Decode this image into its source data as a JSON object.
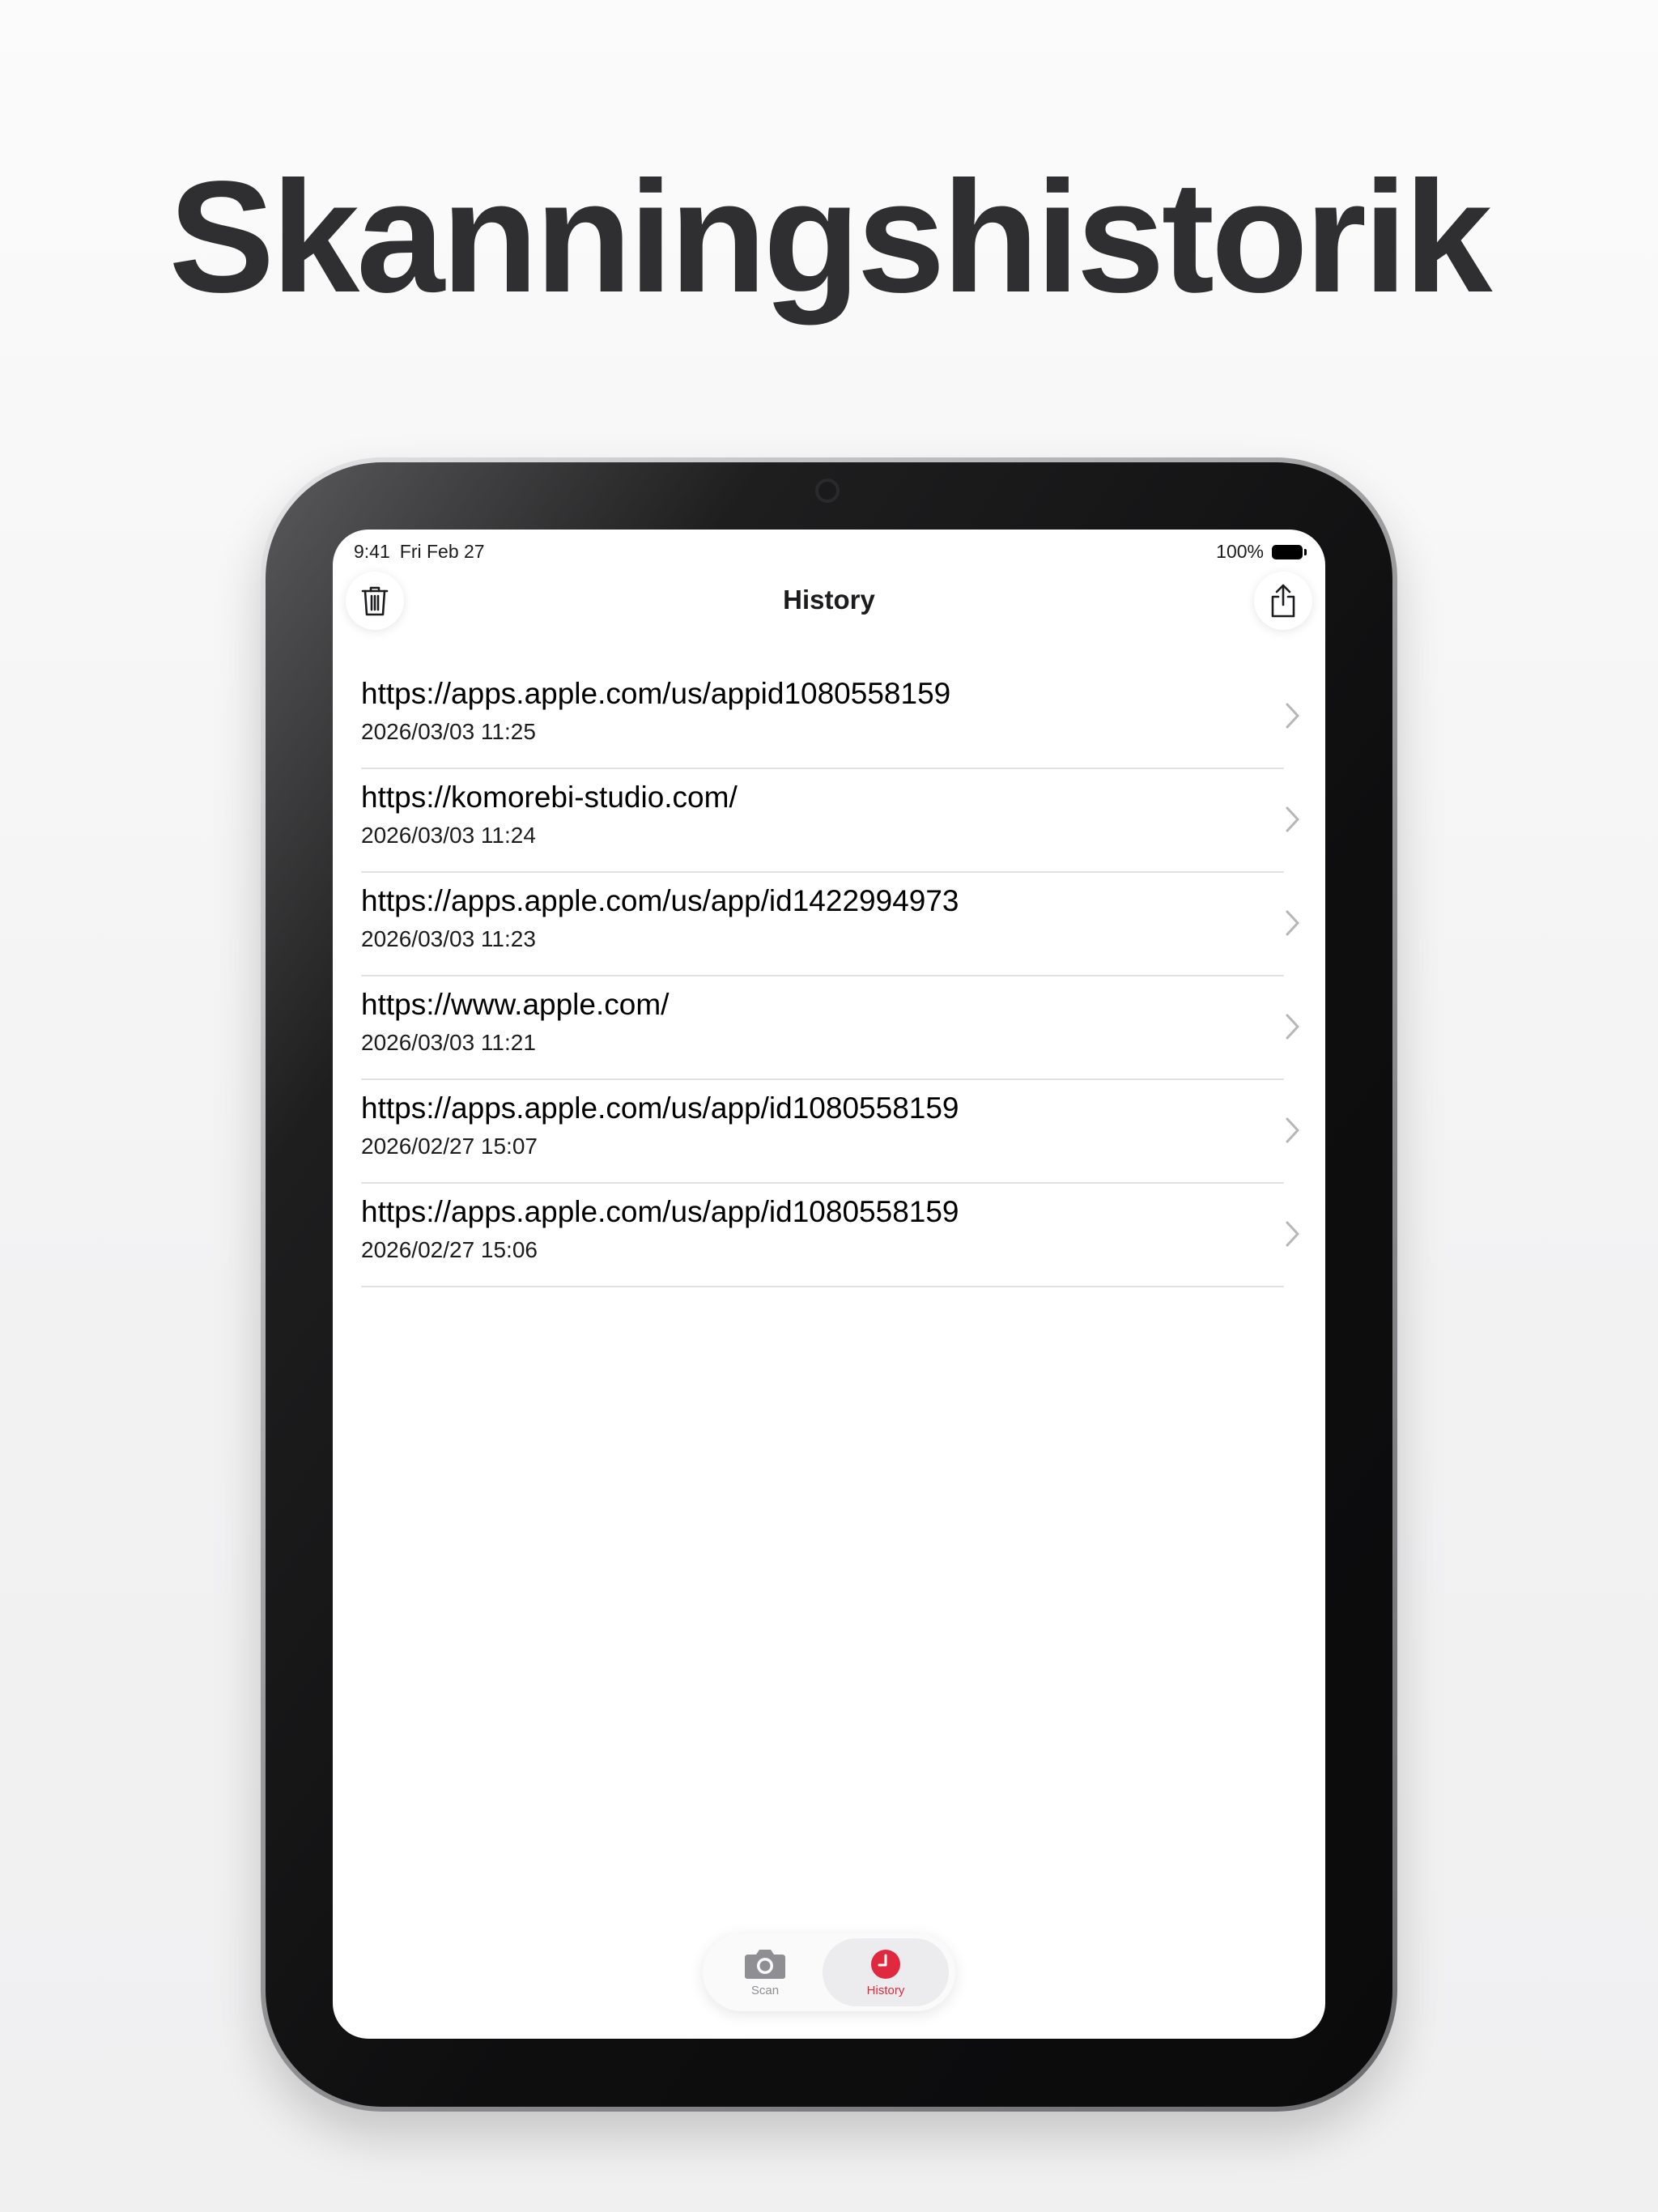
{
  "headline": "Skanningshistorik",
  "status_bar": {
    "time": "9:41",
    "date": "Fri Feb 27",
    "battery": "100%"
  },
  "nav": {
    "title": "History",
    "left_icon": "trash-icon",
    "right_icon": "share-icon"
  },
  "history": [
    {
      "url": "https://apps.apple.com/us/appid1080558159",
      "date": "2026/03/03 11:25"
    },
    {
      "url": "https://komorebi-studio.com/",
      "date": "2026/03/03 11:24"
    },
    {
      "url": "https://apps.apple.com/us/app/id1422994973",
      "date": "2026/03/03 11:23"
    },
    {
      "url": "https://www.apple.com/",
      "date": "2026/03/03 11:21"
    },
    {
      "url": "https://apps.apple.com/us/app/id1080558159",
      "date": "2026/02/27 15:07"
    },
    {
      "url": "https://apps.apple.com/us/app/id1080558159",
      "date": "2026/02/27 15:06"
    }
  ],
  "tabbar": {
    "tabs": [
      {
        "label": "Scan",
        "icon": "camera-icon",
        "selected": false
      },
      {
        "label": "History",
        "icon": "clock-icon",
        "selected": true
      }
    ]
  },
  "colors": {
    "accent": "#e0283e",
    "separator": "#e2e2e4",
    "headline": "#2f2f31"
  }
}
